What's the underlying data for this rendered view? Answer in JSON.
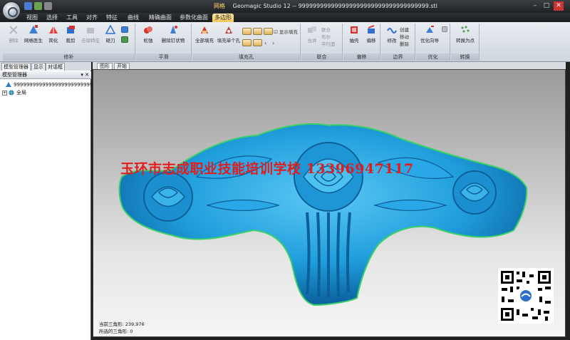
{
  "window": {
    "context_label": "网格",
    "title": "Geomagic Studio 12 -- 999999999999999999999999999999999999.stl",
    "minimize": "–",
    "maximize": "□",
    "close": "✕"
  },
  "ribbon_tabs": [
    "视图",
    "选择",
    "工具",
    "对齐",
    "特征",
    "曲线",
    "精确曲面",
    "参数化曲面",
    "多边形"
  ],
  "active_tab": "多边形",
  "ribbon": {
    "groups": {
      "repair": "修补",
      "smooth": "平滑",
      "fill": "填充孔",
      "combine": "联合",
      "offset": "偏移",
      "boundary": "边界",
      "optimize": "优化",
      "convert": "转换"
    },
    "buttons": {
      "delete": "删除",
      "mesh_doctor": "网格医生",
      "simplify": "简化",
      "trim": "裁剪",
      "remove_feature": "去除特征",
      "flip": "砸刀",
      "relax": "松弛",
      "remove_spikes": "删除钉状物",
      "fill_all": "全部填充",
      "fill_single": "填充单个孔",
      "show_hole": "显示填充",
      "combine": "合并",
      "shell": "抽壳",
      "offset": "偏移",
      "edit": "修改",
      "optimize_wizard": "优化向导",
      "convert_point": "转换为点"
    },
    "small_items": {
      "combine_a": "联合",
      "combine_b": "布尔",
      "combine_c": "平行面",
      "boundary_a": "创建",
      "boundary_b": "移动",
      "boundary_c": "删除"
    }
  },
  "left_panel": {
    "tabs": [
      "模型管理器",
      "显示",
      "对话框"
    ],
    "header": "模型管理器",
    "header_icons": "▾ ✕",
    "items": [
      {
        "label": "999999999999999999999999999999999999"
      },
      {
        "label": "全局"
      }
    ]
  },
  "view_tabs": [
    "图形",
    "开始"
  ],
  "viewport": {
    "watermark": "玉环市志成职业技能培训学校  13396947117",
    "status_current_label": "当前三角形:",
    "status_current_value": "239,976",
    "status_selected_label": "所选的三角形:",
    "status_selected_value": "0"
  },
  "colors": {
    "model": "#1f9edc",
    "watermark": "#e21d1d",
    "active_tab": "#f3c65c"
  }
}
